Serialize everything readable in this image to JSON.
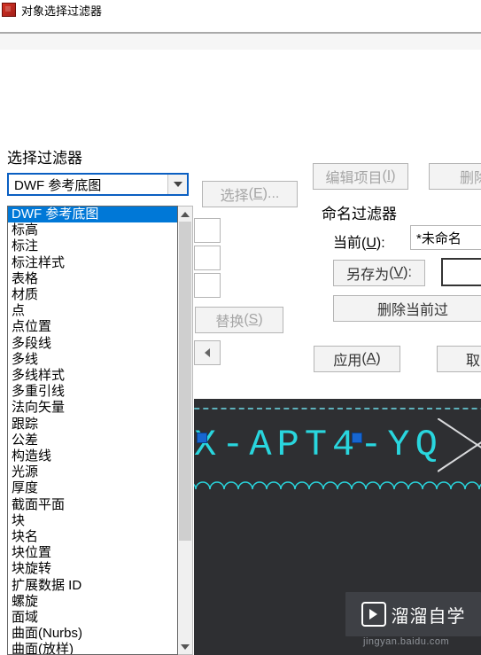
{
  "window": {
    "title": "对象选择过滤器"
  },
  "labels": {
    "select_filter": "选择过滤器",
    "named_filter": "命名过滤器",
    "current": "当前"
  },
  "combo": {
    "selected": "DWF 参考底图",
    "options": [
      "DWF 参考底图",
      "标高",
      "标注",
      "标注样式",
      "表格",
      "材质",
      "点",
      "点位置",
      "多段线",
      "多线",
      "多线样式",
      "多重引线",
      "法向矢量",
      "跟踪",
      "公差",
      "构造线",
      "光源",
      "厚度",
      "截面平面",
      "块",
      "块名",
      "块位置",
      "块旋转",
      "扩展数据 ID",
      "螺旋",
      "面域",
      "曲面(Nurbs)",
      "曲面(放样)"
    ]
  },
  "buttons": {
    "select": "选择",
    "select_key": "E",
    "edit_item": "编辑项目",
    "edit_item_key": "I",
    "delete": "删除",
    "replace": "替换",
    "replace_key": "S",
    "save_as": "另存为",
    "save_as_key": "V",
    "delete_current": "删除当前过",
    "apply": "应用",
    "apply_key": "A",
    "cancel": "取",
    "current_key": "U"
  },
  "fields": {
    "current_value": "*未命名"
  },
  "cad": {
    "text": "X-APT4-YQ"
  },
  "watermark": {
    "text": "溜溜自学",
    "url": "jingyan.baidu.com"
  }
}
